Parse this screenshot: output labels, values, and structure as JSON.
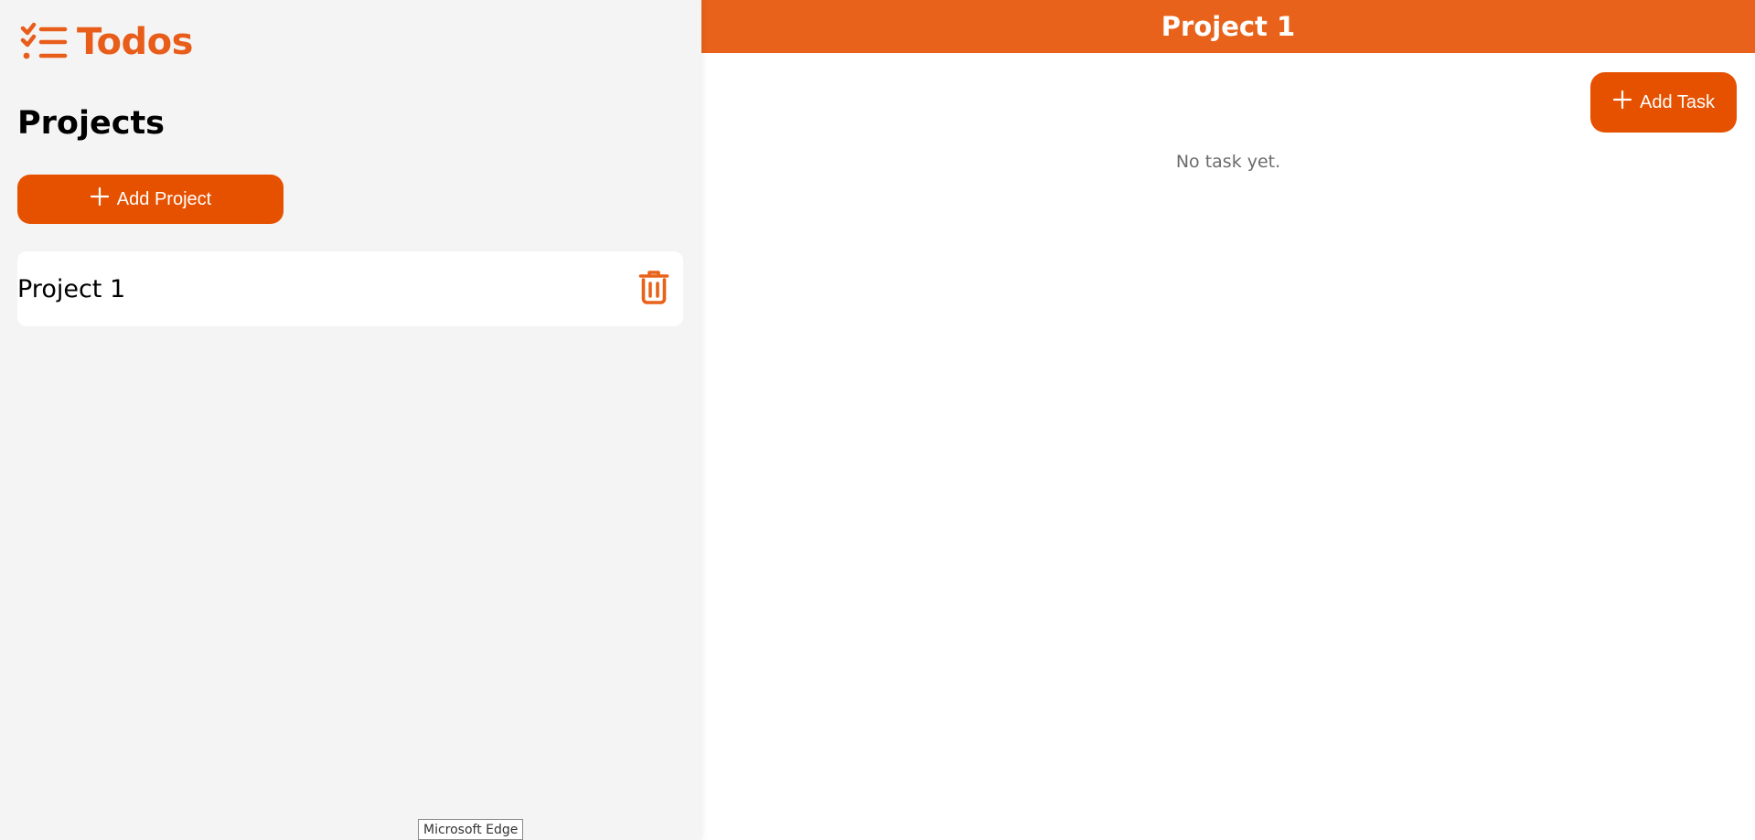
{
  "brand": {
    "name": "Todos",
    "icon": "checklist-icon",
    "color": "#e85d1a"
  },
  "sidebar": {
    "heading": "Projects",
    "add_project_label": "Add Project",
    "add_icon": "plus-icon",
    "projects": [
      {
        "name": "Project 1",
        "delete_icon": "trash-icon"
      }
    ]
  },
  "main": {
    "title": "Project 1",
    "add_task_label": "Add Task",
    "empty_message": "No task yet."
  },
  "tooltip": {
    "text": "Microsoft Edge"
  },
  "colors": {
    "accent": "#e65100",
    "header": "#e8621b",
    "sidebar_bg": "#f4f4f4"
  }
}
